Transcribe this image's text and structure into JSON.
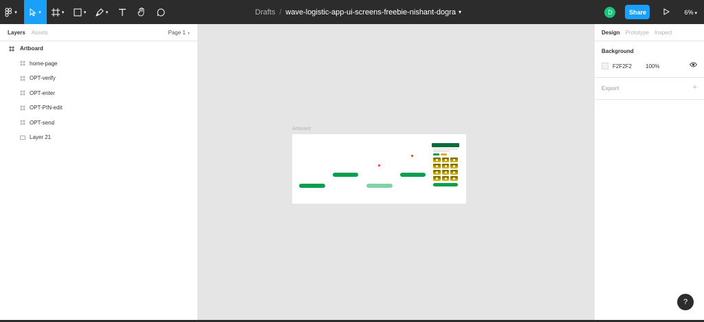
{
  "toolbar": {
    "breadcrumb_drafts": "Drafts",
    "breadcrumb_sep": "/",
    "file_name": "wave-logistic-app-ui-screens-freebie-nishant-dogra",
    "avatar_initial": "D",
    "share_label": "Share",
    "zoom_label": "6%",
    "colors": {
      "bar": "#2c2c2c",
      "accent": "#18a0fb",
      "avatar": "#1bc47d"
    },
    "tools": [
      "figma-menu-icon",
      "move-icon",
      "frame-icon",
      "shape-icon",
      "pen-icon",
      "text-icon",
      "hand-icon",
      "comment-icon"
    ]
  },
  "left_panel": {
    "tabs": [
      "Layers",
      "Assets"
    ],
    "page_label": "Page 1",
    "artboard_label": "Artboard",
    "layers": [
      "home-page",
      "OPT-verify",
      "OPT-enter",
      "OPT-PIN-edit",
      "OPT-send",
      "Layer 21"
    ]
  },
  "canvas": {
    "artboard_label": "Artboard",
    "colors": {
      "pill": "#0a9e4f",
      "pill_light": "#7fd3a6",
      "marker": "#ff3b3b",
      "header": "#0c6b3a"
    }
  },
  "right_panel": {
    "tabs": [
      "Design",
      "Prototype",
      "Inspect"
    ],
    "background_title": "Background",
    "background_hex": "F2F2F2",
    "background_opacity": "100%",
    "export_title": "Export",
    "export_plus": "+",
    "help_label": "?"
  }
}
